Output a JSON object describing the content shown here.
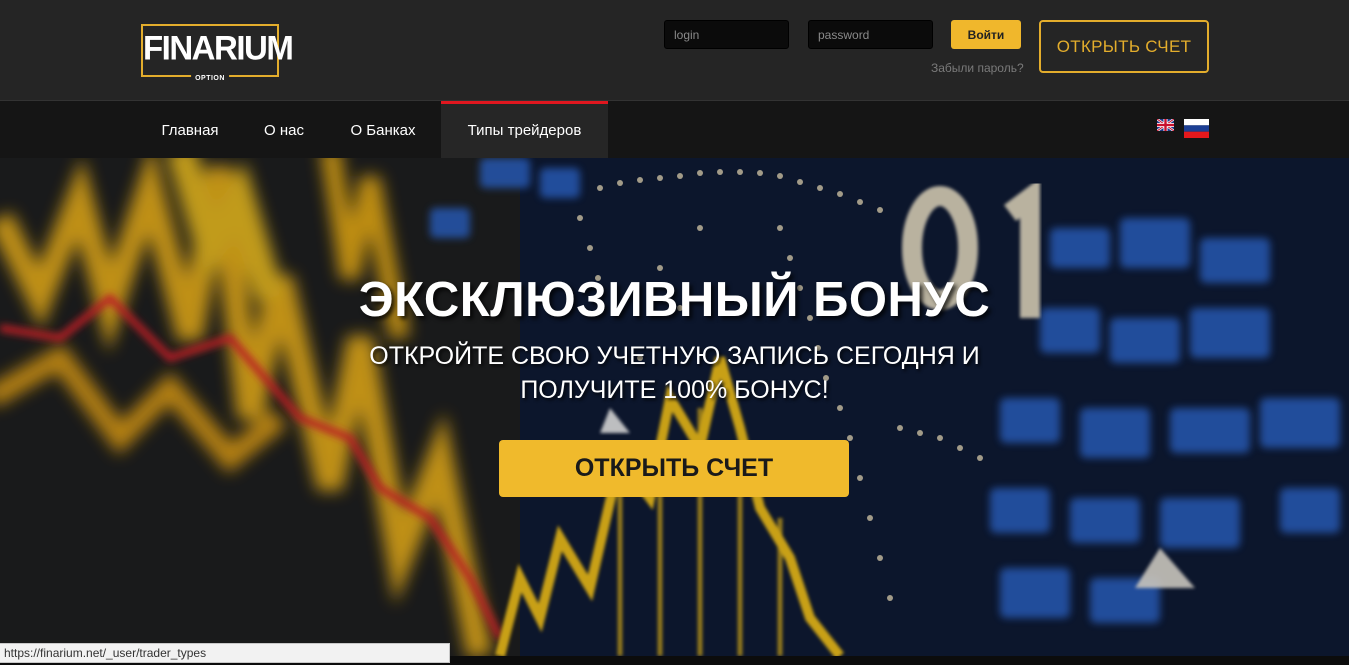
{
  "header": {
    "logo_text": "FINARIUM",
    "logo_sub": "OPTION",
    "login_placeholder": "login",
    "password_placeholder": "password",
    "login_button": "Войти",
    "forgot_password": "Забыли пароль?",
    "open_account_button": "ОТКРЫТЬ СЧЕТ"
  },
  "nav": {
    "items": [
      {
        "label": "Главная"
      },
      {
        "label": "О нас"
      },
      {
        "label": "О Банках"
      },
      {
        "label": "Типы трейдеров",
        "active": true
      }
    ],
    "languages": [
      "en-flag-icon",
      "ru-flag-icon"
    ]
  },
  "hero": {
    "title": "ЭКСКЛЮЗИВНЫЙ БОНУС",
    "subtitle_line1": "ОТКРОЙТЕ СВОЮ УЧЕТНУЮ ЗАПИСЬ СЕГОДНЯ И",
    "subtitle_line2": "ПОЛУЧИТЕ 100% БОНУС!",
    "cta_button": "ОТКРЫТЬ СЧЕТ"
  },
  "status_bar": {
    "url": "https://finarium.net/_user/trader_types"
  },
  "colors": {
    "accent": "#f0b72c",
    "nav_active_border": "#e0171f",
    "header_bg": "#252525"
  }
}
